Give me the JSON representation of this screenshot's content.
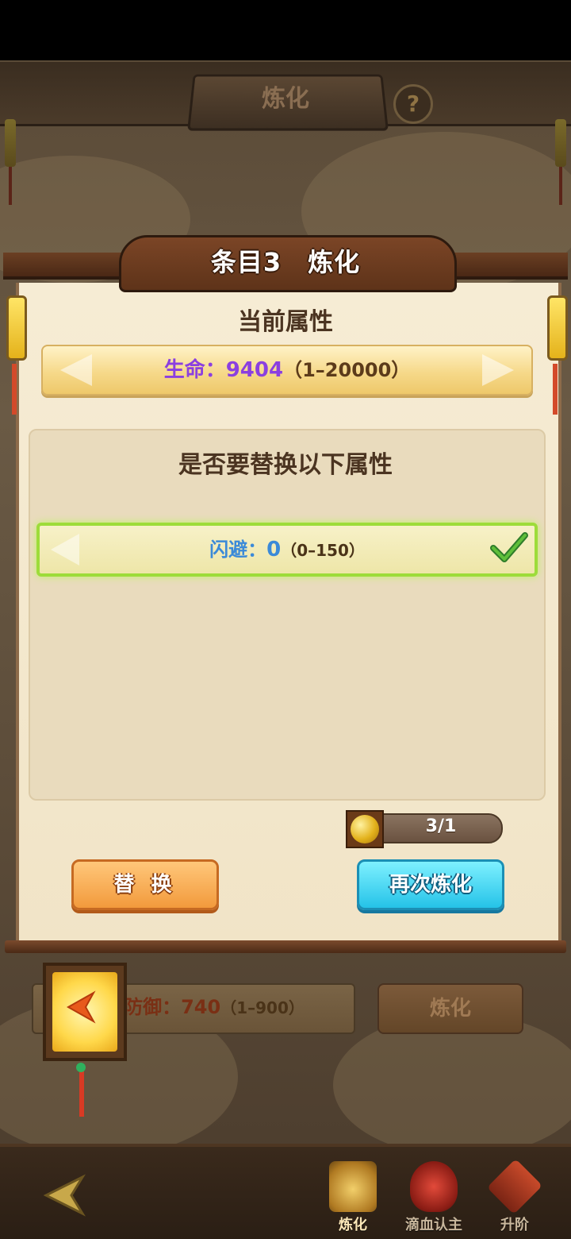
{
  "screen_title": "炼化",
  "help_label": "?",
  "modal": {
    "title": "条目3　炼化",
    "current_label": "当前属性",
    "current_stat": {
      "name": "生命：",
      "value": "9404",
      "range": "（1–20000）"
    },
    "offer_label": "是否要替换以下属性",
    "offer_option": {
      "name": "闪避：",
      "value": "0",
      "range": "（0–150）",
      "selected": true
    },
    "currency": {
      "icon": "gold-coin-icon",
      "count": "3/1"
    },
    "replace_label": "替 换",
    "refine_again_label": "再次炼化"
  },
  "background_row": {
    "stat_name": "防御：",
    "stat_value": "740",
    "stat_range": "（1–900）",
    "button_label": "炼化"
  },
  "bottom_nav": {
    "items": [
      {
        "label": "炼化",
        "icon": "refine-cauldron-icon"
      },
      {
        "label": "滴血认主",
        "icon": "blood-drop-icon"
      },
      {
        "label": "升阶",
        "icon": "upgrade-icon"
      }
    ]
  },
  "colors": {
    "current_stat": "#8b3fe0",
    "offer_stat": "#3b8ad8",
    "replace_button": "#f29a3c",
    "refine_button": "#25c3e8",
    "selected_border": "#9ddc3a"
  }
}
